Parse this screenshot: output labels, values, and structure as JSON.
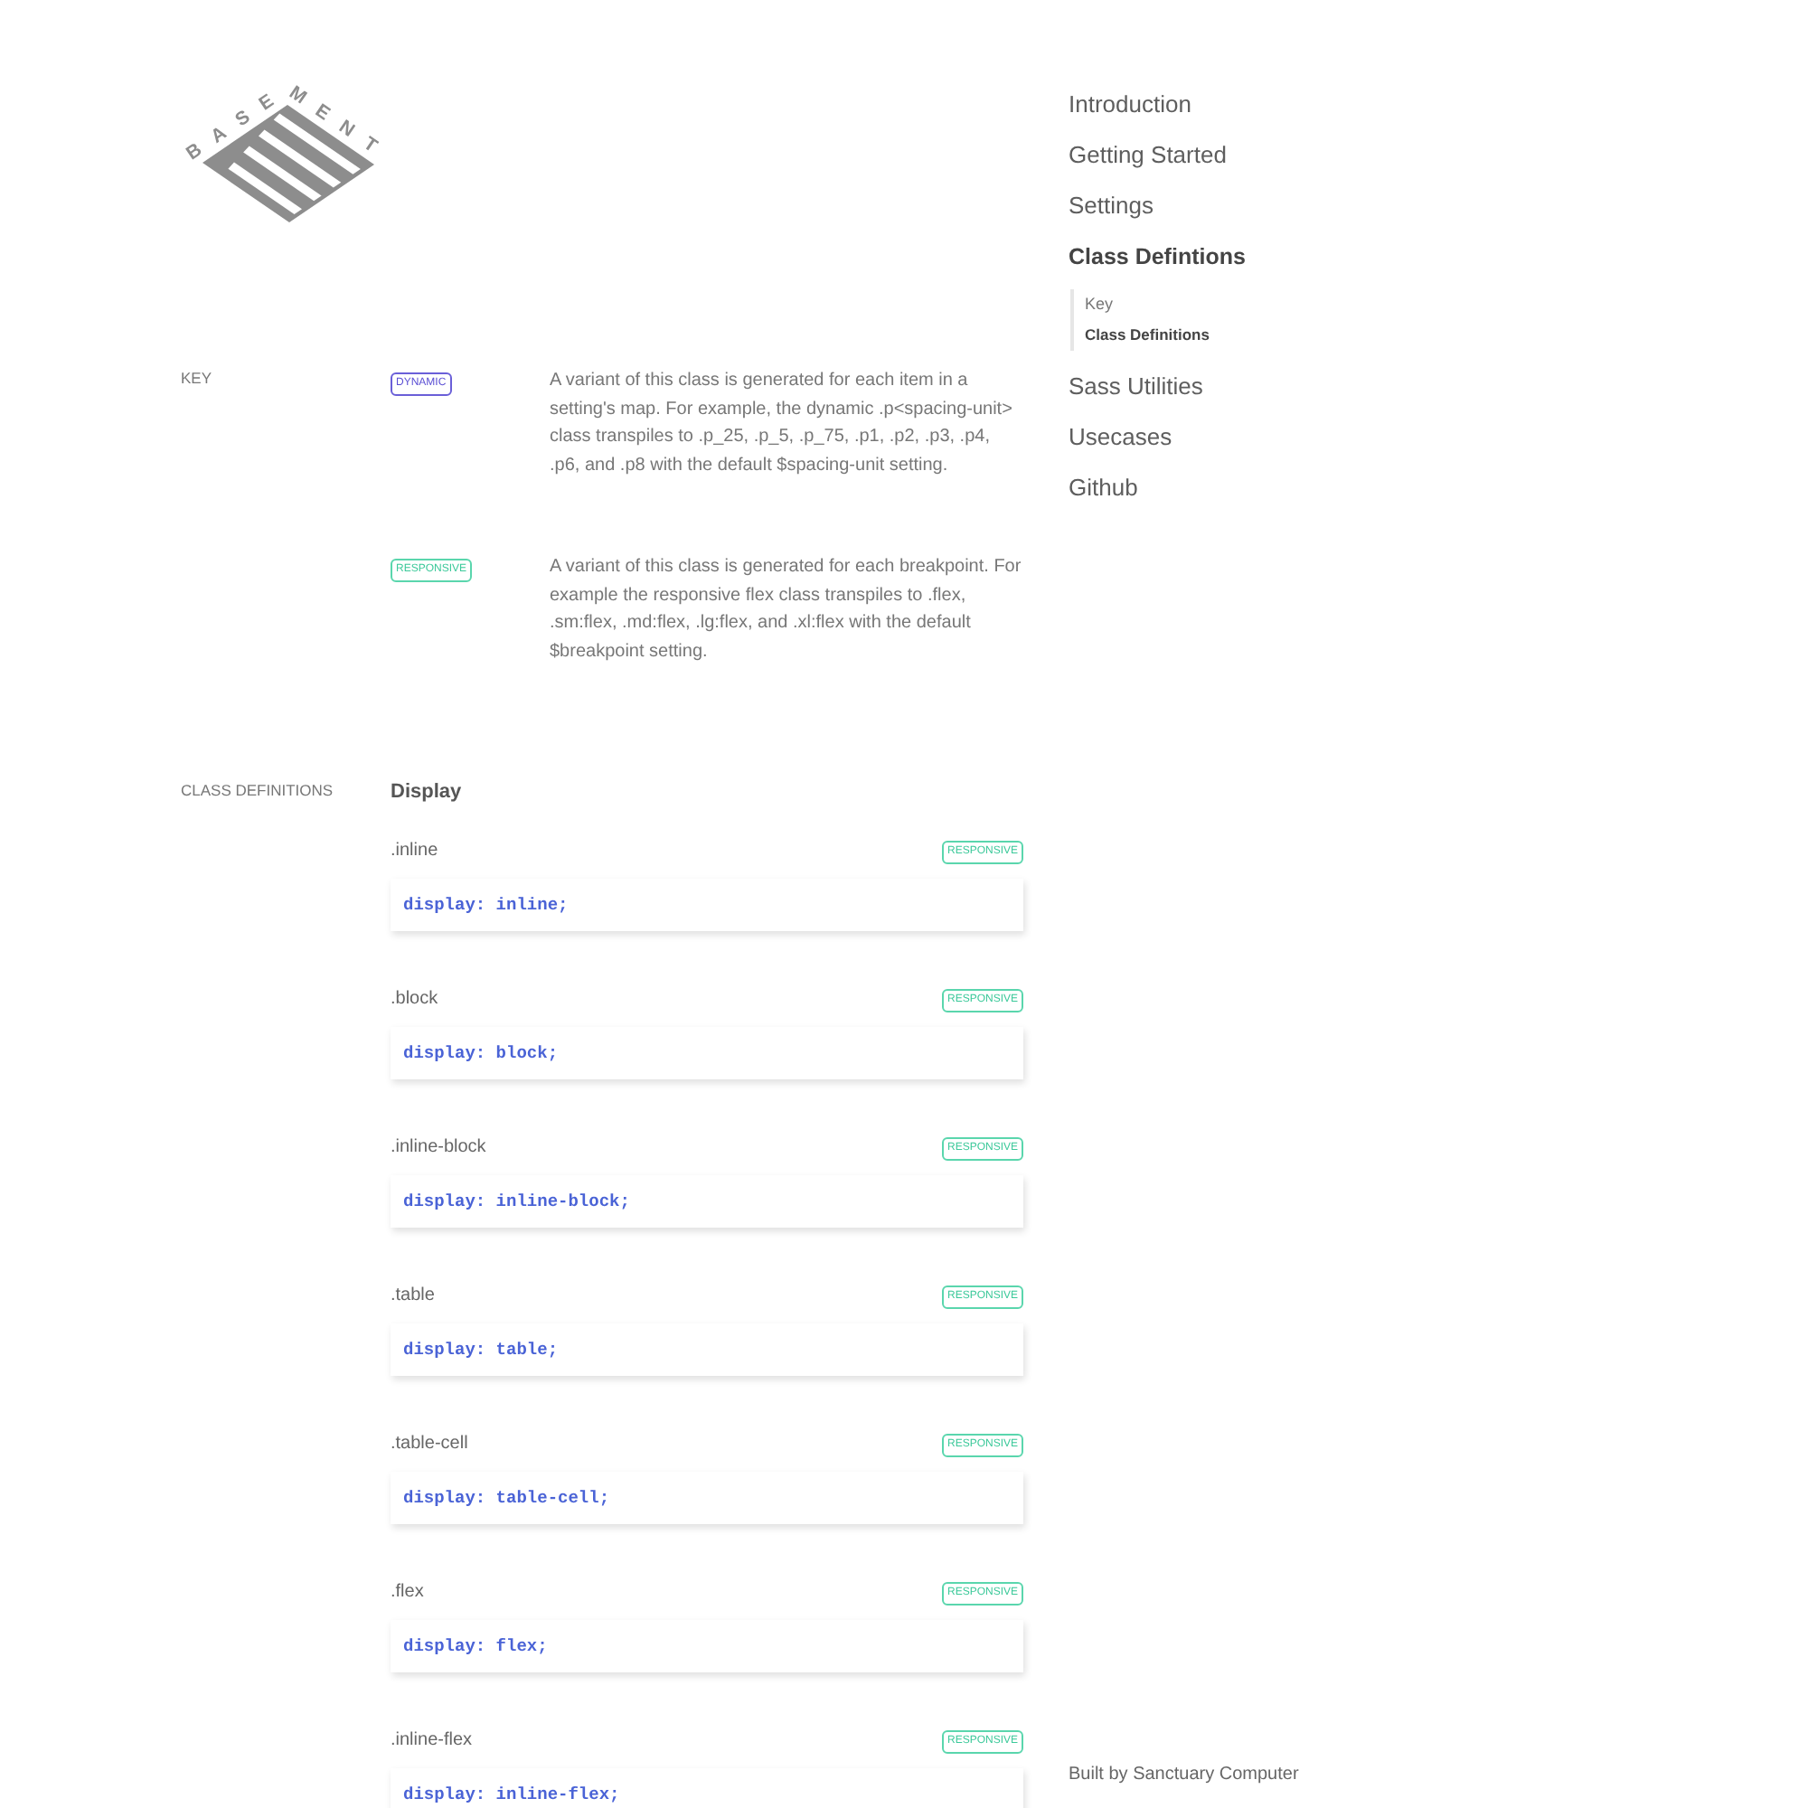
{
  "logo": {
    "wordmark": "BASEMENT"
  },
  "nav": {
    "items": [
      {
        "label": "Introduction",
        "selected": false
      },
      {
        "label": "Getting Started",
        "selected": false
      },
      {
        "label": "Settings",
        "selected": false
      },
      {
        "label": "Class Defintions",
        "selected": true,
        "children": [
          {
            "label": "Key",
            "selected": false
          },
          {
            "label": "Class Definitions",
            "selected": true
          }
        ]
      },
      {
        "label": "Sass Utilities",
        "selected": false
      },
      {
        "label": "Usecases",
        "selected": false
      },
      {
        "label": "Github",
        "selected": false
      }
    ]
  },
  "key": {
    "label": "KEY",
    "entries": [
      {
        "kind": "dynamic",
        "badge": "DYNAMIC",
        "description": "A variant of this class is generated for each item in a setting's map. For example, the dynamic .p<spacing-unit> class transpiles to .p_25, .p_5, .p_75, .p1, .p2, .p3, .p4, .p6, and .p8 with the default $spacing-unit setting."
      },
      {
        "kind": "responsive",
        "badge": "RESPONSIVE",
        "description": "A variant of this class is generated for each breakpoint. For example the responsive flex class transpiles to .flex, .sm:flex, .md:flex, .lg:flex, and .xl:flex with the default $breakpoint setting."
      }
    ]
  },
  "class_definitions": {
    "label": "CLASS DEFINITIONS",
    "groups": [
      {
        "title": "Display",
        "classes": [
          {
            "name": ".inline",
            "kind": "responsive",
            "badge": "RESPONSIVE",
            "code": "display: inline;"
          },
          {
            "name": ".block",
            "kind": "responsive",
            "badge": "RESPONSIVE",
            "code": "display: block;"
          },
          {
            "name": ".inline-block",
            "kind": "responsive",
            "badge": "RESPONSIVE",
            "code": "display: inline-block;"
          },
          {
            "name": ".table",
            "kind": "responsive",
            "badge": "RESPONSIVE",
            "code": "display: table;"
          },
          {
            "name": ".table-cell",
            "kind": "responsive",
            "badge": "RESPONSIVE",
            "code": "display: table-cell;"
          },
          {
            "name": ".flex",
            "kind": "responsive",
            "badge": "RESPONSIVE",
            "code": "display: flex;"
          },
          {
            "name": ".inline-flex",
            "kind": "responsive",
            "badge": "RESPONSIVE",
            "code": "display: inline-flex;"
          }
        ]
      }
    ]
  },
  "footer": {
    "credit": "Built by Sanctuary Computer"
  }
}
